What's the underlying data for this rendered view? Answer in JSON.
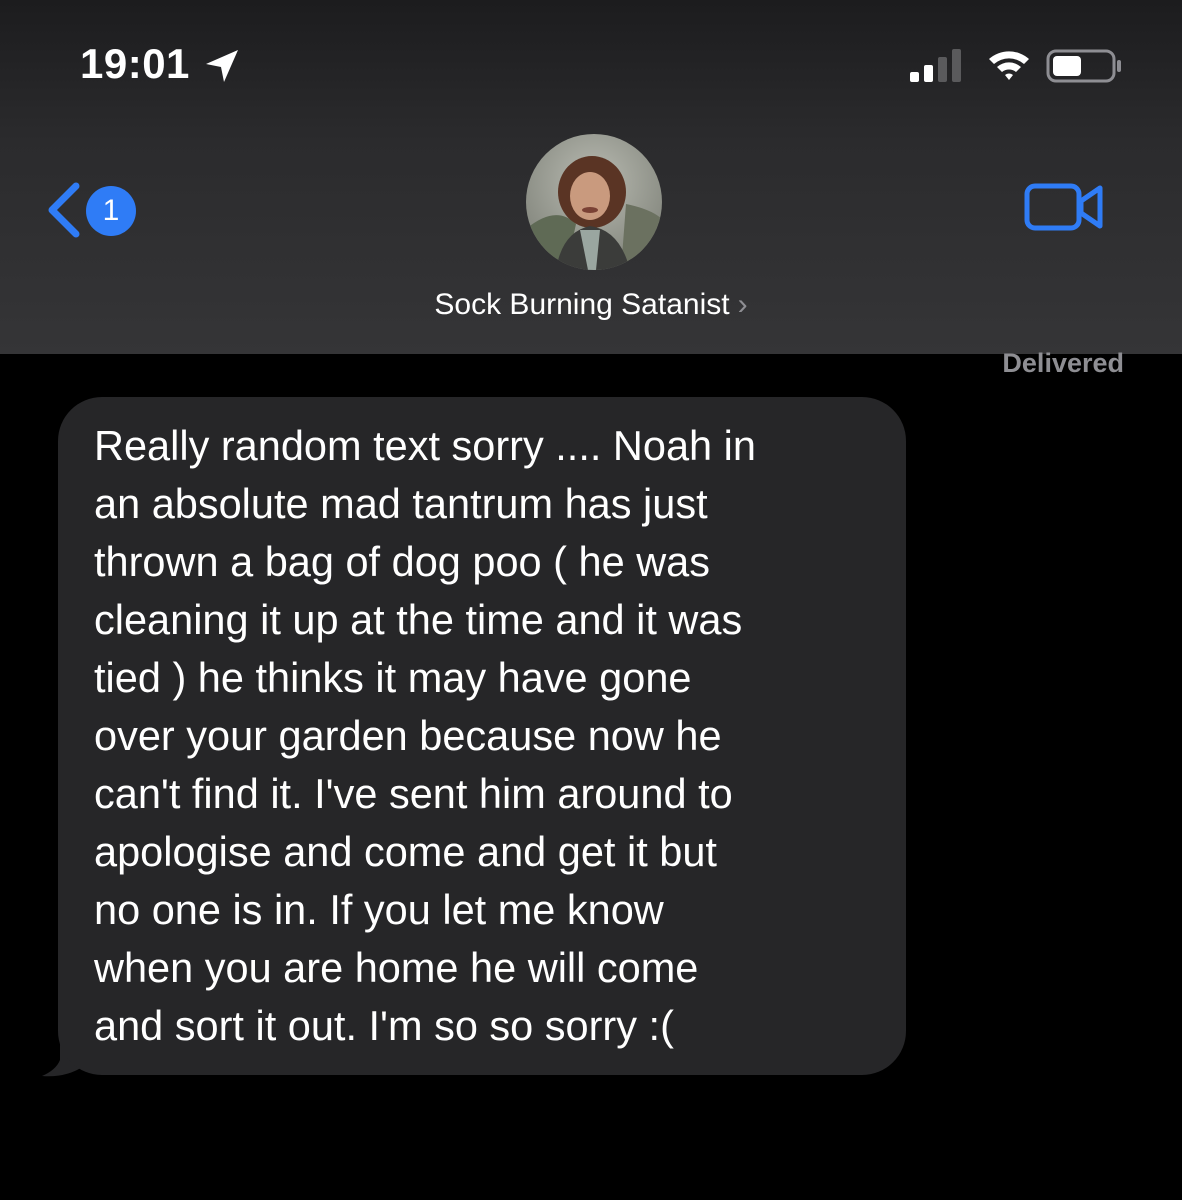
{
  "status_bar": {
    "time": "19:01",
    "icons": [
      "location-arrow-icon",
      "cellular-signal-icon",
      "wifi-icon",
      "battery-icon"
    ]
  },
  "nav": {
    "back_badge_count": "1",
    "contact_name": "Sock Burning Satanist",
    "contact_chevron": "›",
    "icons": [
      "back-chevron-icon",
      "video-camera-icon"
    ]
  },
  "conversation": {
    "delivered_label": "Delivered",
    "messages": [
      {
        "direction": "incoming",
        "lines": [
          "Really random text sorry .... Noah in",
          "an absolute mad tantrum has just",
          "thrown a bag of dog poo ( he was",
          "cleaning it up at the time and it was",
          "tied ) he thinks it may have gone",
          "over your garden because now he",
          "can't find it.  I've sent him around to",
          "apologise and come and get it but",
          "no one is in. If you let me know",
          "when you are home he will come",
          "and sort it out. I'm so so sorry :("
        ]
      }
    ]
  },
  "colors": {
    "accent": "#2f7cf6",
    "incoming_bubble": "#262628",
    "header_bg": "#353537",
    "secondary_text": "#8e8e93"
  }
}
